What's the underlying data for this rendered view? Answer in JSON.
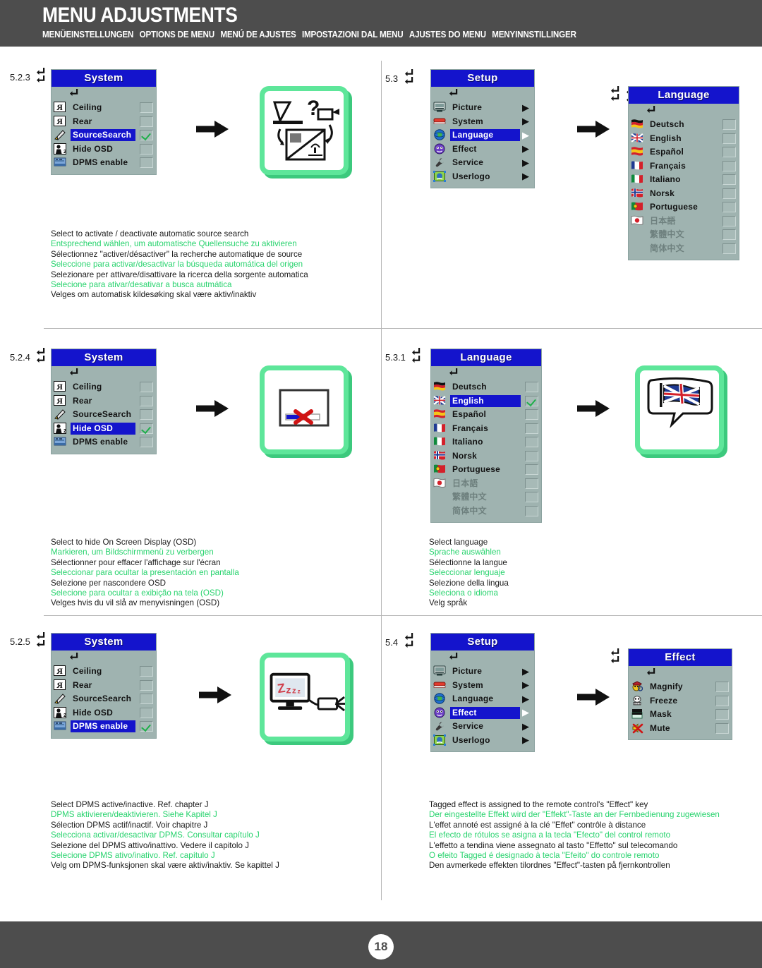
{
  "header": {
    "title": "MENU ADJUSTMENTS",
    "subtitles": [
      "MENÜEINSTELLUNGEN",
      "OPTIONS DE MENU",
      "MENÚ DE AJUSTES",
      "IMPOSTAZIONI DAL MENU",
      "AJUSTES DO MENU",
      "MENYINNSTILLINGER"
    ]
  },
  "footer": {
    "page_number": "18"
  },
  "colors": {
    "header_bg": "#4d4d4d",
    "osd_title_bg": "#1414cc",
    "osd_body_bg": "#9fb3b0",
    "highlight_bg": "#1414cc",
    "check_green": "#1faf4a",
    "illustration_frame": "#5ee69a",
    "caption_green": "#27d36d"
  },
  "sections": [
    {
      "number": "5.2.3",
      "menu": {
        "title": "System",
        "items": [
          {
            "label": "Ceiling",
            "icon": "ceiling-icon",
            "checked": false,
            "selected": false
          },
          {
            "label": "Rear",
            "icon": "rear-icon",
            "checked": false,
            "selected": false
          },
          {
            "label": "SourceSearch",
            "icon": "source-search-icon",
            "checked": true,
            "selected": true
          },
          {
            "label": "Hide OSD",
            "icon": "hide-osd-icon",
            "checked": false,
            "selected": false
          },
          {
            "label": "DPMS enable",
            "icon": "dpms-icon",
            "checked": false,
            "selected": false
          }
        ]
      },
      "illustration": "source-search-illustration",
      "caption": {
        "en": "Select to activate / deactivate automatic source search",
        "de": "Entsprechend wählen, um automatische Quellensuche zu aktivieren",
        "fr": "Sélectionnez \"activer/désactiver\" la recherche automatique de source",
        "es": "Seleccione para activar/desactivar la búsqueda automática del origen",
        "it": "Selezionare per attivare/disattivare la ricerca della sorgente automatica",
        "pt": "Selecione para ativar/desativar a busca autmática",
        "no": "Velges om automatisk kildesøking skal være aktiv/inaktiv"
      }
    },
    {
      "number": "5.3",
      "menu": {
        "title": "Setup",
        "items": [
          {
            "label": "Picture",
            "icon": "picture-icon",
            "submenu": true,
            "selected": false
          },
          {
            "label": "System",
            "icon": "system-icon",
            "submenu": true,
            "selected": false
          },
          {
            "label": "Language",
            "icon": "language-icon",
            "submenu": true,
            "selected": true
          },
          {
            "label": "Effect",
            "icon": "effect-icon",
            "submenu": true,
            "selected": false
          },
          {
            "label": "Service",
            "icon": "service-icon",
            "submenu": true,
            "selected": false
          },
          {
            "label": "Userlogo",
            "icon": "userlogo-icon",
            "submenu": true,
            "selected": false
          }
        ]
      },
      "submenu": {
        "title": "Language",
        "items": [
          {
            "label": "Deutsch",
            "icon": "flag-germany",
            "checked": false,
            "selected": false,
            "dim": false
          },
          {
            "label": "English",
            "icon": "flag-uk",
            "checked": false,
            "selected": false,
            "dim": false
          },
          {
            "label": "Español",
            "icon": "flag-spain",
            "checked": false,
            "selected": false,
            "dim": false
          },
          {
            "label": "Français",
            "icon": "flag-france",
            "checked": false,
            "selected": false,
            "dim": false
          },
          {
            "label": "Italiano",
            "icon": "flag-italy",
            "checked": false,
            "selected": false,
            "dim": false
          },
          {
            "label": "Norsk",
            "icon": "flag-norway",
            "checked": false,
            "selected": false,
            "dim": false
          },
          {
            "label": "Portuguese",
            "icon": "flag-portugal",
            "checked": false,
            "selected": false,
            "dim": false
          },
          {
            "label": "日本語",
            "icon": "flag-japan",
            "checked": false,
            "selected": false,
            "dim": true
          },
          {
            "label": "繁體中文",
            "icon": "none",
            "checked": false,
            "selected": false,
            "dim": true
          },
          {
            "label": "简体中文",
            "icon": "none",
            "checked": false,
            "selected": false,
            "dim": true
          }
        ]
      }
    },
    {
      "number": "5.2.4",
      "menu": {
        "title": "System",
        "items": [
          {
            "label": "Ceiling",
            "icon": "ceiling-icon",
            "checked": false,
            "selected": false
          },
          {
            "label": "Rear",
            "icon": "rear-icon",
            "checked": false,
            "selected": false
          },
          {
            "label": "SourceSearch",
            "icon": "source-search-icon",
            "checked": false,
            "selected": false
          },
          {
            "label": "Hide OSD",
            "icon": "hide-osd-icon",
            "checked": true,
            "selected": true
          },
          {
            "label": "DPMS enable",
            "icon": "dpms-icon",
            "checked": false,
            "selected": false
          }
        ]
      },
      "illustration": "hide-osd-illustration",
      "caption": {
        "en": "Select to hide On Screen Display (OSD)",
        "de": "Markieren, um Bildschirmmenü zu verbergen",
        "fr": "Sélectionner pour effacer l'affichage sur l'écran",
        "es": "Seleccionar para ocultar la presentación en pantalla",
        "it": "Selezione per nascondere OSD",
        "pt": "Selecione para ocultar a exibição na tela (OSD)",
        "no": "Velges hvis du vil slå av menyvisningen (OSD)"
      }
    },
    {
      "number": "5.3.1",
      "menu": {
        "title": "Language",
        "items": [
          {
            "label": "Deutsch",
            "icon": "flag-germany",
            "checked": false,
            "selected": false,
            "dim": false
          },
          {
            "label": "English",
            "icon": "flag-uk",
            "checked": true,
            "selected": true,
            "dim": false
          },
          {
            "label": "Español",
            "icon": "flag-spain",
            "checked": false,
            "selected": false,
            "dim": false
          },
          {
            "label": "Français",
            "icon": "flag-france",
            "checked": false,
            "selected": false,
            "dim": false
          },
          {
            "label": "Italiano",
            "icon": "flag-italy",
            "checked": false,
            "selected": false,
            "dim": false
          },
          {
            "label": "Norsk",
            "icon": "flag-norway",
            "checked": false,
            "selected": false,
            "dim": false
          },
          {
            "label": "Portuguese",
            "icon": "flag-portugal",
            "checked": false,
            "selected": false,
            "dim": false
          },
          {
            "label": "日本語",
            "icon": "flag-japan",
            "checked": false,
            "selected": false,
            "dim": true
          },
          {
            "label": "繁體中文",
            "icon": "none",
            "checked": false,
            "selected": false,
            "dim": true
          },
          {
            "label": "简体中文",
            "icon": "none",
            "checked": false,
            "selected": false,
            "dim": true
          }
        ]
      },
      "illustration": "language-flag-illustration",
      "caption": {
        "en": "Select language",
        "de": "Sprache auswählen",
        "fr": "Sélectionne la langue",
        "es": "Seleccionar lenguaje",
        "it": "Selezione della lingua",
        "pt": "Seleciona o idioma",
        "no": "Velg språk"
      }
    },
    {
      "number": "5.2.5",
      "menu": {
        "title": "System",
        "items": [
          {
            "label": "Ceiling",
            "icon": "ceiling-icon",
            "checked": false,
            "selected": false
          },
          {
            "label": "Rear",
            "icon": "rear-icon",
            "checked": false,
            "selected": false
          },
          {
            "label": "SourceSearch",
            "icon": "source-search-icon",
            "checked": false,
            "selected": false
          },
          {
            "label": "Hide OSD",
            "icon": "hide-osd-icon",
            "checked": false,
            "selected": false
          },
          {
            "label": "DPMS enable",
            "icon": "dpms-icon",
            "checked": true,
            "selected": true
          }
        ]
      },
      "illustration": "dpms-sleep-illustration",
      "caption": {
        "en": "Select DPMS active/inactive. Ref. chapter J",
        "de": "DPMS aktivieren/deaktivieren. Siehe Kapitel J",
        "fr": "Sélection DPMS actif/inactif. Voir chapitre J",
        "es": "Selecciona activar/desactivar DPMS. Consultar capítulo J",
        "it": "Selezione del DPMS attivo/inattivo. Vedere il capitolo J",
        "pt": "Selecione DPMS ativo/inativo. Ref. capítulo J",
        "no": "Velg om DPMS-funksjonen skal være aktiv/inaktiv. Se kapittel J"
      }
    },
    {
      "number": "5.4",
      "menu": {
        "title": "Setup",
        "items": [
          {
            "label": "Picture",
            "icon": "picture-icon",
            "submenu": true,
            "selected": false
          },
          {
            "label": "System",
            "icon": "system-icon",
            "submenu": true,
            "selected": false
          },
          {
            "label": "Language",
            "icon": "language-icon",
            "submenu": true,
            "selected": false
          },
          {
            "label": "Effect",
            "icon": "effect-icon",
            "submenu": true,
            "selected": true
          },
          {
            "label": "Service",
            "icon": "service-icon",
            "submenu": true,
            "selected": false
          },
          {
            "label": "Userlogo",
            "icon": "userlogo-icon",
            "submenu": true,
            "selected": false
          }
        ]
      },
      "submenu": {
        "title": "Effect",
        "items": [
          {
            "label": "Magnify",
            "icon": "magnify-icon",
            "checked": false,
            "selected": false
          },
          {
            "label": "Freeze",
            "icon": "freeze-icon",
            "checked": false,
            "selected": false
          },
          {
            "label": "Mask",
            "icon": "mask-icon",
            "checked": false,
            "selected": false
          },
          {
            "label": "Mute",
            "icon": "mute-icon",
            "checked": false,
            "selected": false
          }
        ]
      },
      "caption": {
        "en": "Tagged effect is assigned to the remote control's \"Effect\" key",
        "de": "Der eingestellte Effekt wird der \"Effekt\"-Taste an der Fernbedienung zugewiesen",
        "fr": "L'effet annoté est assigné à la clé \"Effet\" contrôle à distance",
        "es": "El efecto de rótulos se asigna a la tecla \"Efecto\" del control remoto",
        "it": "L'effetto a tendina viene assegnato al tasto \"Effetto\" sul telecomando",
        "pt": "O efeito Tagged é designado à tecla \"Efeito\" do controle remoto",
        "no": "Den avmerkede effekten tilordnes \"Effect\"-tasten på  fjernkontrollen"
      }
    }
  ]
}
